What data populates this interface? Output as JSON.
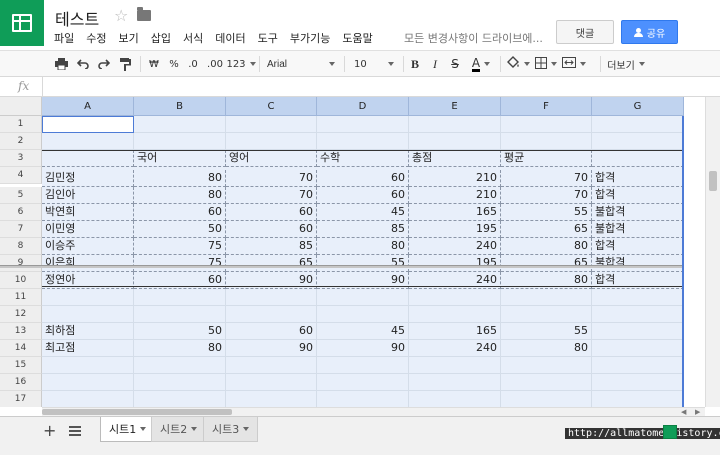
{
  "app": {
    "doc_title": "테스트",
    "menus": [
      "파일",
      "수정",
      "보기",
      "삽입",
      "서식",
      "데이터",
      "도구",
      "부가기능",
      "도움말"
    ],
    "save_status": "모든 변경사항이 드라이브에...",
    "comment_label": "댓글",
    "share_label": "공유",
    "accent_color": "#4d90fe",
    "brand_color": "#0f9d58"
  },
  "toolbar": {
    "print_icon": "print-icon",
    "undo_icon": "undo-icon",
    "redo_icon": "redo-icon",
    "paint_format_icon": "paint-format-icon",
    "currency_label": "₩",
    "percent_label": "%",
    "decrease_decimal_label": ".0",
    "increase_decimal_label": ".00",
    "more_formats_label": "123",
    "font_family": "Arial",
    "font_size": "10",
    "bold_label": "B",
    "italic_label": "I",
    "strike_label": "S",
    "text_color_label": "A",
    "more_label": "더보기"
  },
  "formula_bar": {
    "fx_label": "fx",
    "value": ""
  },
  "sheet": {
    "columns": [
      "A",
      "B",
      "C",
      "D",
      "E",
      "F",
      "G"
    ],
    "rows": [
      "1",
      "2",
      "3",
      "4",
      "5",
      "6",
      "7",
      "8",
      "9",
      "10",
      "11",
      "12",
      "13",
      "14",
      "15",
      "16",
      "17"
    ],
    "headers": {
      "b": "국어",
      "c": "영어",
      "d": "수학",
      "e": "총점",
      "f": "평균"
    },
    "students": [
      {
        "name": "김민정",
        "kor": 80,
        "eng": 70,
        "math": 60,
        "total": 210,
        "avg": 70,
        "result": "합격"
      },
      {
        "name": "김인아",
        "kor": 80,
        "eng": 70,
        "math": 60,
        "total": 210,
        "avg": 70,
        "result": "합격"
      },
      {
        "name": "박연희",
        "kor": 60,
        "eng": 60,
        "math": 45,
        "total": 165,
        "avg": 55,
        "result": "불합격"
      },
      {
        "name": "이민영",
        "kor": 50,
        "eng": 60,
        "math": 85,
        "total": 195,
        "avg": 65,
        "result": "불합격"
      },
      {
        "name": "이승주",
        "kor": 75,
        "eng": 85,
        "math": 80,
        "total": 240,
        "avg": 80,
        "result": "합격"
      },
      {
        "name": "이은희",
        "kor": 75,
        "eng": 65,
        "math": 55,
        "total": 195,
        "avg": 65,
        "result": "불합격"
      },
      {
        "name": "정연아",
        "kor": 60,
        "eng": 90,
        "math": 90,
        "total": 240,
        "avg": 80,
        "result": "합격"
      }
    ],
    "summary": [
      {
        "label": "최하점",
        "kor": 50,
        "eng": 60,
        "math": 45,
        "total": 165,
        "avg": 55
      },
      {
        "label": "최고점",
        "kor": 80,
        "eng": 90,
        "math": 90,
        "total": 240,
        "avg": 80
      }
    ]
  },
  "tabs": {
    "add_icon": "+",
    "items": [
      "시트1",
      "시트2",
      "시트3"
    ],
    "active": 0
  },
  "watermark": "http://allmatome.tistory.com"
}
